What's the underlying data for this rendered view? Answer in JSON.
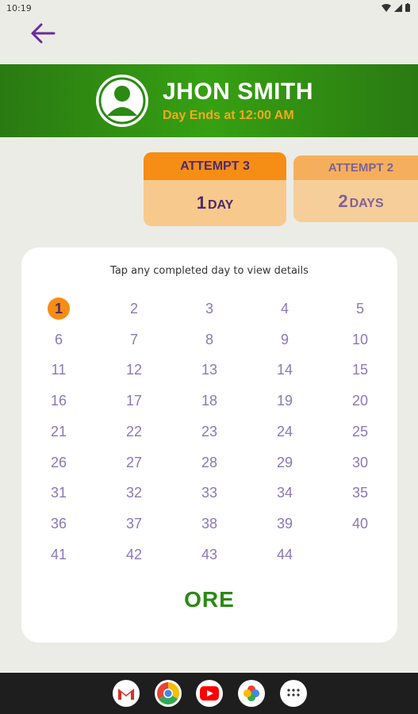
{
  "status": {
    "time": "10:19"
  },
  "banner": {
    "name": "JHON SMITH",
    "subtitle": "Day Ends at 12:00 AM"
  },
  "attempts": [
    {
      "label": "ATTEMPT 3",
      "value": "1",
      "unit": "DAY"
    },
    {
      "label": "ATTEMPT 2",
      "value": "2",
      "unit": "DAYS"
    }
  ],
  "calendar": {
    "hint": "Tap any completed day to view details",
    "days": [
      "1",
      "2",
      "3",
      "4",
      "5",
      "6",
      "7",
      "8",
      "9",
      "10",
      "11",
      "12",
      "13",
      "14",
      "15",
      "16",
      "17",
      "18",
      "19",
      "20",
      "21",
      "22",
      "23",
      "24",
      "25",
      "26",
      "27",
      "28",
      "29",
      "30",
      "31",
      "32",
      "33",
      "34",
      "35",
      "36",
      "37",
      "38",
      "39",
      "40",
      "41",
      "42",
      "43",
      "44"
    ],
    "active_day": "1",
    "footer_text": "ORE"
  },
  "dock": [
    "gmail-icon",
    "chrome-icon",
    "youtube-icon",
    "photos-icon",
    "apps-icon"
  ],
  "colors": {
    "accent_orange": "#f68d14",
    "banner_green": "#36a012",
    "day_purple": "#8a78b8"
  }
}
